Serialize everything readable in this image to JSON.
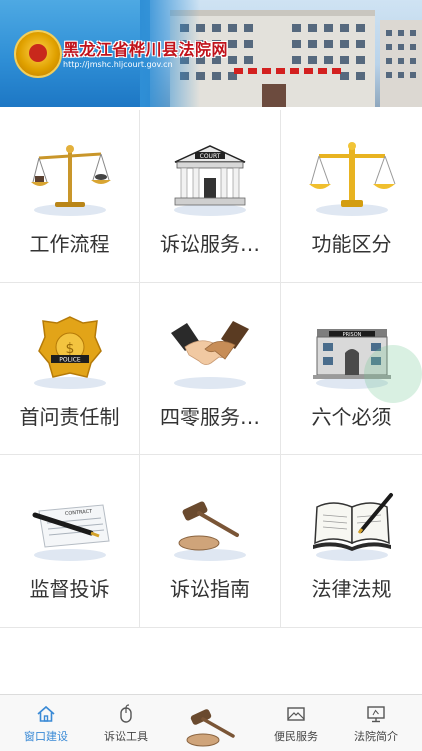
{
  "header": {
    "title": "黑龙江省桦川县法院网",
    "url": "http://jmshc.hljcourt.gov.cn"
  },
  "grid": {
    "items": [
      {
        "label": "工作流程",
        "icon": "balance-scale-icon"
      },
      {
        "label": "诉讼服务…",
        "icon": "court-building-icon"
      },
      {
        "label": "功能区分",
        "icon": "scales-icon"
      },
      {
        "label": "首问责任制",
        "icon": "police-badge-icon"
      },
      {
        "label": "四零服务…",
        "icon": "handshake-icon"
      },
      {
        "label": "六个必须",
        "icon": "prison-icon"
      },
      {
        "label": "监督投诉",
        "icon": "contract-pen-icon"
      },
      {
        "label": "诉讼指南",
        "icon": "gavel-icon"
      },
      {
        "label": "法律法规",
        "icon": "law-book-icon"
      }
    ]
  },
  "tabbar": {
    "items": [
      {
        "label": "窗口建设",
        "icon": "home-icon",
        "active": true
      },
      {
        "label": "诉讼工具",
        "icon": "mouse-icon",
        "active": false
      },
      {
        "label": "",
        "icon": "gavel-icon",
        "active": false
      },
      {
        "label": "便民服务",
        "icon": "mail-icon",
        "active": false
      },
      {
        "label": "法院简介",
        "icon": "monitor-icon",
        "active": false
      }
    ]
  },
  "colors": {
    "accent": "#3a8ad6",
    "title_red": "#c1121b",
    "banner_blue": "#2f8fd6"
  }
}
